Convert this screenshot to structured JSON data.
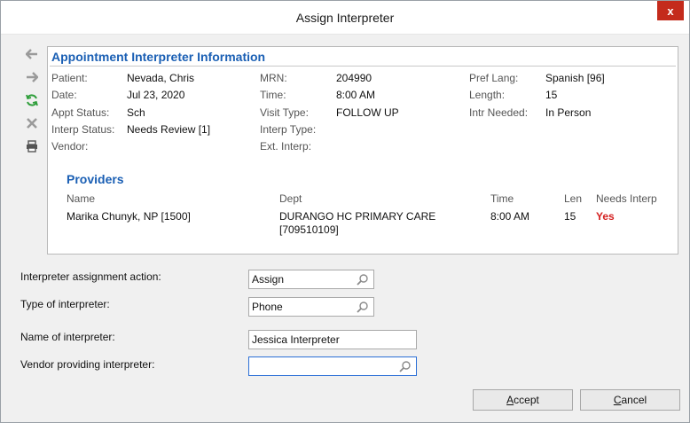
{
  "window": {
    "title": "Assign Interpreter",
    "close_label": "x"
  },
  "toolbar": {
    "icons": [
      "back-arrow-icon",
      "forward-arrow-icon",
      "refresh-icon",
      "delete-icon",
      "print-icon"
    ],
    "colors": {
      "arrow": "#9a9a9a",
      "refresh": "#2e9e3a",
      "delete": "#9a9a9a",
      "print": "#555555"
    }
  },
  "appointment": {
    "section_title": "Appointment Interpreter Information",
    "patient_label": "Patient:",
    "patient": "Nevada, Chris",
    "date_label": "Date:",
    "date": "Jul 23, 2020",
    "appt_status_label": "Appt Status:",
    "appt_status": "Sch",
    "interp_status_label": "Interp Status:",
    "interp_status": "Needs Review [1]",
    "vendor_label": "Vendor:",
    "mrn_label": "MRN:",
    "mrn": "204990",
    "time_label": "Time:",
    "time": "8:00 AM",
    "visit_type_label": "Visit Type:",
    "visit_type": "FOLLOW UP",
    "interp_type_label": "Interp Type:",
    "ext_interp_label": "Ext. Interp:",
    "pref_lang_label": "Pref Lang:",
    "pref_lang": "Spanish [96]",
    "length_label": "Length:",
    "length": "15",
    "intr_needed_label": "Intr Needed:",
    "intr_needed": "In Person"
  },
  "providers": {
    "title": "Providers",
    "headers": {
      "name": "Name",
      "dept": "Dept",
      "time": "Time",
      "len": "Len",
      "needs": "Needs Interp"
    },
    "rows": [
      {
        "name": "Marika Chunyk, NP [1500]",
        "dept_line1": "DURANGO HC PRIMARY CARE",
        "dept_line2": "[709510109]",
        "time": "8:00 AM",
        "len": "15",
        "needs": "Yes"
      }
    ]
  },
  "form": {
    "action_label": "Interpreter assignment action:",
    "action_value": "Assign",
    "type_label": "Type of interpreter:",
    "type_value": "Phone",
    "name_label": "Name of interpreter:",
    "name_value": "Jessica Interpreter",
    "vendor_label": "Vendor providing interpreter:",
    "vendor_value": ""
  },
  "buttons": {
    "accept": "ccept",
    "accept_mnemonic": "A",
    "cancel": "ancel",
    "cancel_mnemonic": "C"
  }
}
